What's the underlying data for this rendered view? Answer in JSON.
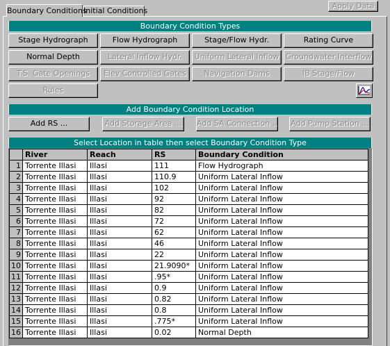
{
  "tabs": [
    {
      "label": "Boundary Conditions",
      "active": true
    },
    {
      "label": "Initial Conditions",
      "active": false
    }
  ],
  "apply_button": {
    "label": "Apply Data",
    "enabled": false
  },
  "types_section": {
    "title": "Boundary Condition Types",
    "buttons": [
      {
        "label": "Stage Hydrograph",
        "enabled": true
      },
      {
        "label": "Flow Hydrograph",
        "enabled": true
      },
      {
        "label": "Stage/Flow Hydr.",
        "enabled": true
      },
      {
        "label": "Rating Curve",
        "enabled": true
      },
      {
        "label": "Normal Depth",
        "enabled": true
      },
      {
        "label": "Lateral Inflow Hydr.",
        "enabled": false
      },
      {
        "label": "Uniform Lateral Inflow",
        "enabled": false
      },
      {
        "label": "Groundwater Interflow",
        "enabled": false
      },
      {
        "label": "T.S. Gate Openings",
        "enabled": false
      },
      {
        "label": "Elev Controlled Gates",
        "enabled": false
      },
      {
        "label": "Navigation Dams",
        "enabled": false
      },
      {
        "label": "IB Stage/Flow",
        "enabled": false
      },
      {
        "label": "Rules",
        "enabled": false
      }
    ],
    "plot_icon": "hydrograph-plot-icon"
  },
  "location_section": {
    "title": "Add Boundary Condition Location",
    "buttons": [
      {
        "label": "Add RS ...",
        "enabled": true
      },
      {
        "label": "Add Storage Area ...",
        "enabled": false
      },
      {
        "label": "Add SA Connection ...",
        "enabled": false
      },
      {
        "label": "Add Pump Station ...",
        "enabled": false
      }
    ]
  },
  "table": {
    "caption": "Select Location in table then select Boundary Condition Type",
    "headers": [
      "River",
      "Reach",
      "RS",
      "Boundary Condition"
    ],
    "rows": [
      {
        "num": "1",
        "river": "Torrente Illasi",
        "reach": "Illasi",
        "rs": "111",
        "bc": "Flow Hydrograph"
      },
      {
        "num": "2",
        "river": "Torrente Illasi",
        "reach": "Illasi",
        "rs": "110.9",
        "bc": "Uniform Lateral Inflow"
      },
      {
        "num": "3",
        "river": "Torrente Illasi",
        "reach": "Illasi",
        "rs": "102",
        "bc": "Uniform Lateral Inflow"
      },
      {
        "num": "4",
        "river": "Torrente Illasi",
        "reach": "Illasi",
        "rs": "92",
        "bc": "Uniform Lateral Inflow"
      },
      {
        "num": "5",
        "river": "Torrente Illasi",
        "reach": "Illasi",
        "rs": "82",
        "bc": "Uniform Lateral Inflow"
      },
      {
        "num": "6",
        "river": "Torrente Illasi",
        "reach": "Illasi",
        "rs": "72",
        "bc": "Uniform Lateral Inflow"
      },
      {
        "num": "7",
        "river": "Torrente Illasi",
        "reach": "Illasi",
        "rs": "62",
        "bc": "Uniform Lateral Inflow"
      },
      {
        "num": "8",
        "river": "Torrente Illasi",
        "reach": "Illasi",
        "rs": "46",
        "bc": "Uniform Lateral Inflow"
      },
      {
        "num": "9",
        "river": "Torrente Illasi",
        "reach": "Illasi",
        "rs": "22",
        "bc": "Uniform Lateral Inflow"
      },
      {
        "num": "10",
        "river": "Torrente Illasi",
        "reach": "Illasi",
        "rs": "21.9090*",
        "bc": "Uniform Lateral Inflow"
      },
      {
        "num": "11",
        "river": "Torrente Illasi",
        "reach": "Illasi",
        "rs": ".95*",
        "bc": "Uniform Lateral Inflow"
      },
      {
        "num": "12",
        "river": "Torrente Illasi",
        "reach": "Illasi",
        "rs": "0.9",
        "bc": "Uniform Lateral Inflow"
      },
      {
        "num": "13",
        "river": "Torrente Illasi",
        "reach": "Illasi",
        "rs": "0.82",
        "bc": "Uniform Lateral Inflow"
      },
      {
        "num": "14",
        "river": "Torrente Illasi",
        "reach": "Illasi",
        "rs": "0.8",
        "bc": "Uniform Lateral Inflow"
      },
      {
        "num": "15",
        "river": "Torrente Illasi",
        "reach": "Illasi",
        "rs": ".775*",
        "bc": "Uniform Lateral Inflow"
      },
      {
        "num": "16",
        "river": "Torrente Illasi",
        "reach": "Illasi",
        "rs": "0.02",
        "bc": "Normal Depth"
      }
    ]
  },
  "colors": {
    "teal_header": "#008080",
    "window_bg": "#c0c0c0",
    "grid_bg": "#808080"
  }
}
